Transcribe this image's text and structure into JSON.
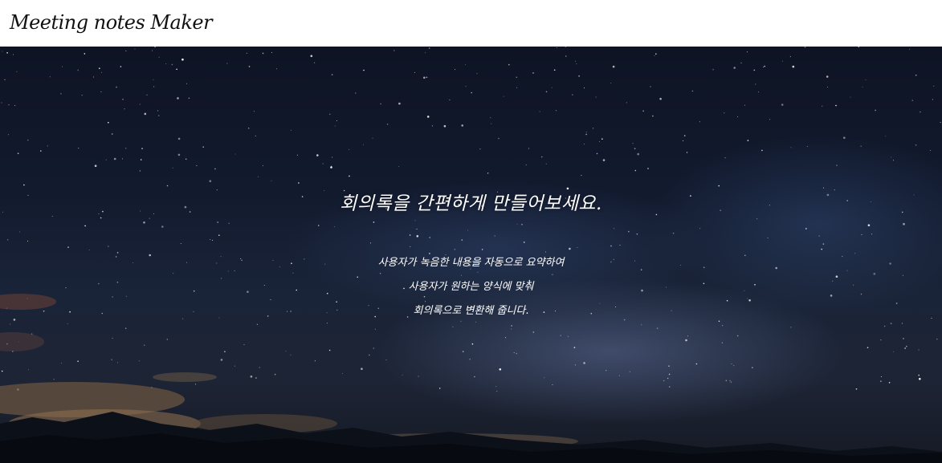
{
  "header": {
    "logo_text": "Meeting notes Maker"
  },
  "hero": {
    "title": "회의록을 간편하게 만들어보세요.",
    "description_lines": [
      "사용자가 녹음한 내용을 자동으로 요약하여",
      "사용자가 원하는 양식에 맞춰",
      "회의록으로 변환해 줍니다."
    ],
    "background_image": "night-sky-milky-way-mountains",
    "colors": {
      "sky_dark": "#0e1424",
      "sky_mid": "#1a2438",
      "text": "#ffffff"
    }
  }
}
